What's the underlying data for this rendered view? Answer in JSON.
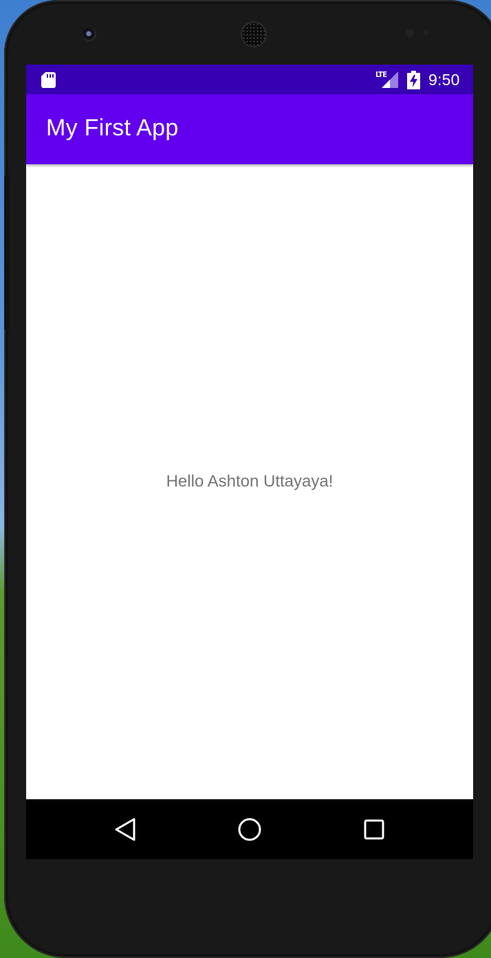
{
  "status_bar": {
    "time": "9:50",
    "network_label": "LTE",
    "icons": [
      "sd-card-icon",
      "lte-signal-icon",
      "battery-charging-icon"
    ]
  },
  "app_bar": {
    "title": "My First App"
  },
  "main": {
    "message": "Hello Ashton Uttayaya!"
  },
  "nav_bar": {
    "icons": [
      "back-icon",
      "home-icon",
      "recents-icon"
    ]
  },
  "colors": {
    "status_bar": "#3700b3",
    "app_bar": "#6200ee",
    "message_text": "#757575",
    "nav_bar": "#000000"
  }
}
